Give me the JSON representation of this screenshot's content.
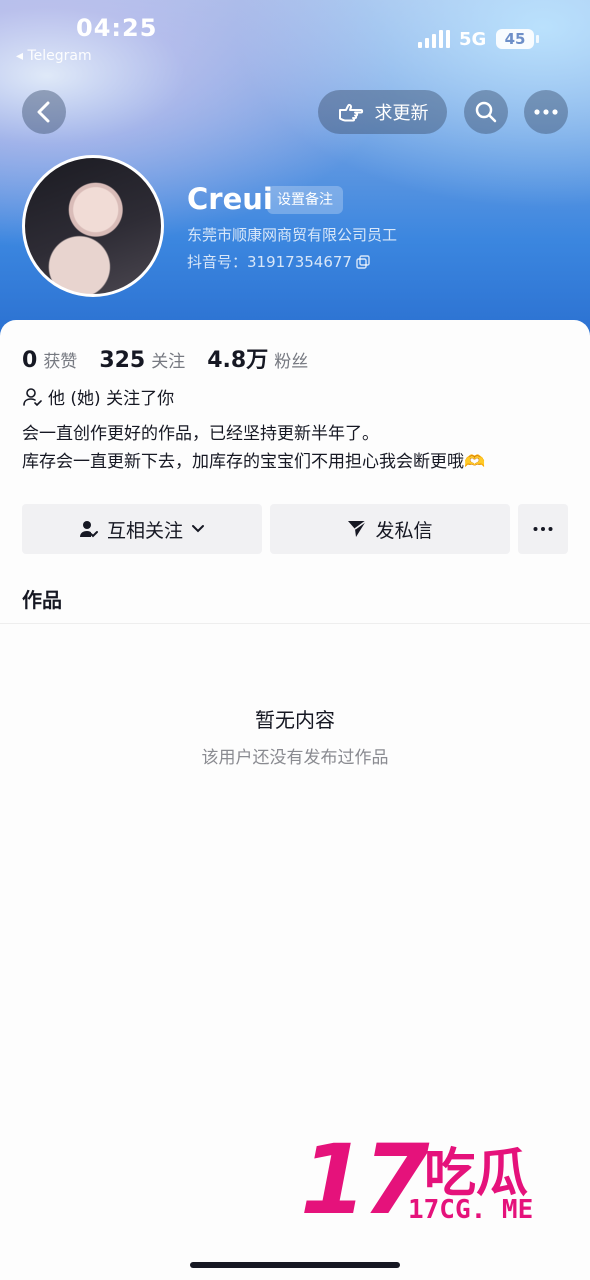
{
  "status_bar": {
    "time": "04:25",
    "back_app": "◂ Telegram",
    "network": "5G",
    "battery": "45"
  },
  "nav": {
    "update_label": "求更新"
  },
  "profile": {
    "name": "Creui",
    "remark_label": "设置备注",
    "company": "东莞市顺康网商贸有限公司员工",
    "douyin_id": "抖音号：31917354677"
  },
  "stats": {
    "likes": {
      "value": "0",
      "label": "获赞"
    },
    "following": {
      "value": "325",
      "label": "关注"
    },
    "followers": {
      "value": "4.8万",
      "label": "粉丝"
    }
  },
  "follows_you": "他 (她) 关注了你",
  "bio": {
    "line1": "会一直创作更好的作品，已经坚持更新半年了。",
    "line2": "库存会一直更新下去，加库存的宝宝们不用担心我会断更哦🫶"
  },
  "actions": {
    "follow_label": "互相关注",
    "message_label": "发私信"
  },
  "tabs": {
    "works": "作品"
  },
  "empty": {
    "title": "暂无内容",
    "subtitle": "该用户还没有发布过作品"
  },
  "watermark": {
    "number": "17",
    "chinese": "吃瓜",
    "url": "17CG. ME"
  },
  "colors": {
    "accent_pink": "#e5127b",
    "header_blue": "#3b86df"
  }
}
